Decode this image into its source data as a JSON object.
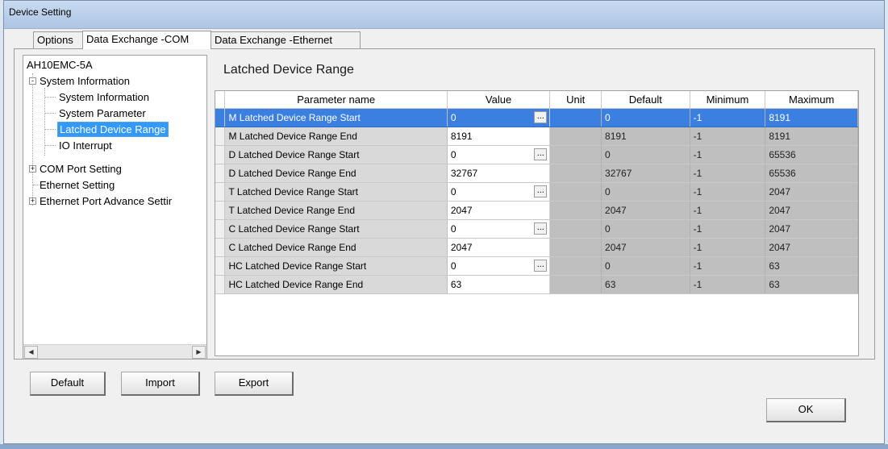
{
  "window": {
    "title": "Device Setting"
  },
  "tabs": [
    "Options",
    "Data Exchange -COM",
    "Data Exchange -Ethernet"
  ],
  "tree": {
    "root": "AH10EMC-5A",
    "items": [
      {
        "label": "System Information",
        "expander": "-"
      },
      {
        "label": "System Information"
      },
      {
        "label": "System Parameter"
      },
      {
        "label": "Latched Device Range",
        "selected": true
      },
      {
        "label": "IO Interrupt"
      },
      {
        "label": "COM Port Setting",
        "expander": "+"
      },
      {
        "label": "Ethernet Setting"
      },
      {
        "label": "Ethernet Port Advance Settir",
        "expander": "+"
      }
    ]
  },
  "panel": {
    "title": "Latched Device Range"
  },
  "grid": {
    "columns": [
      "Parameter name",
      "Value",
      "Unit",
      "Default",
      "Minimum",
      "Maximum"
    ],
    "rows": [
      {
        "name": "M Latched Device Range Start",
        "value": "0",
        "unit": "",
        "default": "0",
        "min": "-1",
        "max": "8191",
        "ellipsis": true,
        "selected": true
      },
      {
        "name": "M Latched Device Range End",
        "value": "8191",
        "unit": "",
        "default": "8191",
        "min": "-1",
        "max": "8191"
      },
      {
        "name": "D Latched Device Range Start",
        "value": "0",
        "unit": "",
        "default": "0",
        "min": "-1",
        "max": "65536",
        "ellipsis": true
      },
      {
        "name": "D Latched Device Range End",
        "value": "32767",
        "unit": "",
        "default": "32767",
        "min": "-1",
        "max": "65536"
      },
      {
        "name": "T Latched Device Range Start",
        "value": "0",
        "unit": "",
        "default": "0",
        "min": "-1",
        "max": "2047",
        "ellipsis": true
      },
      {
        "name": "T Latched Device Range End",
        "value": "2047",
        "unit": "",
        "default": "2047",
        "min": "-1",
        "max": "2047"
      },
      {
        "name": "C Latched Device Range Start",
        "value": "0",
        "unit": "",
        "default": "0",
        "min": "-1",
        "max": "2047",
        "ellipsis": true
      },
      {
        "name": "C Latched Device Range End",
        "value": "2047",
        "unit": "",
        "default": "2047",
        "min": "-1",
        "max": "2047"
      },
      {
        "name": "HC Latched Device Range Start",
        "value": "0",
        "unit": "",
        "default": "0",
        "min": "-1",
        "max": "63",
        "ellipsis": true
      },
      {
        "name": "HC Latched Device Range End",
        "value": "63",
        "unit": "",
        "default": "63",
        "min": "-1",
        "max": "63"
      }
    ]
  },
  "buttons": {
    "default": "Default",
    "import": "Import",
    "export": "Export",
    "ok": "OK"
  },
  "icons": {
    "ellipsis": "...",
    "scroll_left": "◀",
    "scroll_right": "▶"
  }
}
